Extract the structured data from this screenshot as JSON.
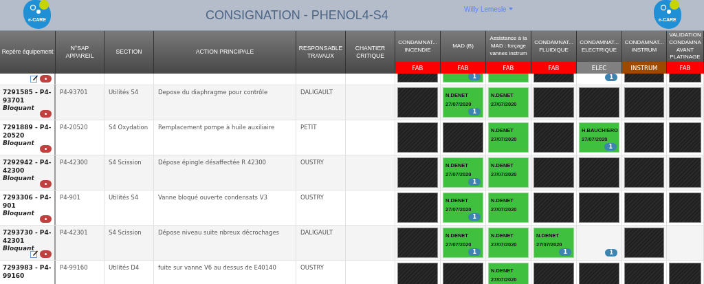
{
  "header": {
    "logo_text": "e-CARE",
    "title": "CONSIGNATION - PHENOL4-S4",
    "user": "Willy Lemesle",
    "logo_text_right": "e-CARE"
  },
  "columns": [
    {
      "kind": "plain",
      "label": "Repère équipement"
    },
    {
      "kind": "plain",
      "label": "N°SAP APPAREIL"
    },
    {
      "kind": "plain",
      "label": "SECTION"
    },
    {
      "kind": "plain",
      "label": "ACTION PRINCIPALE"
    },
    {
      "kind": "plain",
      "label": "RESPONSABLE TRAVAUX"
    },
    {
      "kind": "plain",
      "label": "CHANTIER CRITIQUE"
    },
    {
      "kind": "status",
      "label": "CONDAMNAT... INCENDIE",
      "category": "FAB",
      "color": "#ff0000"
    },
    {
      "kind": "status",
      "label": "MAD (B)",
      "category": "FAB",
      "color": "#ff0000"
    },
    {
      "kind": "status",
      "label": "Assistance à la MAD : forçage vannes instrum",
      "category": "FAB",
      "color": "#ff0000"
    },
    {
      "kind": "status",
      "label": "CONDAMNAT... FLUIDIQUE",
      "category": "FAB",
      "color": "#ff0000"
    },
    {
      "kind": "status",
      "label": "CONDAMNAT... ELECTRIQUE",
      "category": "ELEC",
      "color": "#808080"
    },
    {
      "kind": "status",
      "label": "CONDAMNAT... INSTRUM",
      "category": "INSTRUM",
      "color": "#9c4a00"
    },
    {
      "kind": "status",
      "label": "VALIDATION CONDAMNA AVANT PLATINAGE",
      "category": "FAB",
      "color": "#ff0000"
    }
  ],
  "rows": [
    {
      "partial": true,
      "edit": true,
      "cells": [
        {
          "kind": "blocked"
        },
        {
          "kind": "done",
          "badge": "1"
        },
        {
          "kind": "done"
        },
        {
          "kind": "blocked"
        },
        {
          "kind": "open",
          "badge": "1"
        },
        {
          "kind": "blocked"
        },
        {
          "kind": "blocked"
        }
      ]
    },
    {
      "partial": false,
      "edit": false,
      "id": "7291585 - P4-93701",
      "status": "Bloquant",
      "sap": "P4-93701",
      "section": "Utilités S4",
      "action": "Depose du diaphragme pour contrôle",
      "responsable": "DALIGAULT",
      "cells": [
        {
          "kind": "blocked"
        },
        {
          "kind": "done",
          "name": "N.DENET",
          "date": "27/07/2020",
          "badge": "1"
        },
        {
          "kind": "done",
          "name": "N.DENET",
          "date": "27/07/2020"
        },
        {
          "kind": "blocked"
        },
        {
          "kind": "blocked"
        },
        {
          "kind": "blocked"
        },
        {
          "kind": "blocked"
        }
      ]
    },
    {
      "partial": false,
      "edit": false,
      "id": "7291889 - P4-20520",
      "status": "Bloquant",
      "sap": "P4-20520",
      "section": "S4 Oxydation",
      "action": "Remplacement pompe à huile auxiliaire",
      "responsable": "PETIT",
      "cells": [
        {
          "kind": "blocked"
        },
        {
          "kind": "blocked"
        },
        {
          "kind": "done",
          "name": "N.DENET",
          "date": "27/07/2020"
        },
        {
          "kind": "blocked"
        },
        {
          "kind": "done",
          "name": "H.BAUCHIERO",
          "date": "27/07/2020",
          "badge": "1"
        },
        {
          "kind": "blocked"
        },
        {
          "kind": "blocked"
        }
      ]
    },
    {
      "partial": false,
      "edit": false,
      "id": "7292942 - P4-42300",
      "status": "Bloquant",
      "sap": "P4-42300",
      "section": "S4 Scission",
      "action": "Dépose épingle désaffectée R 42300",
      "responsable": "OUSTRY",
      "cells": [
        {
          "kind": "blocked"
        },
        {
          "kind": "done",
          "name": "N.DENET",
          "date": "27/07/2020",
          "badge": "1"
        },
        {
          "kind": "done",
          "name": "N.DENET",
          "date": "27/07/2020"
        },
        {
          "kind": "blocked"
        },
        {
          "kind": "blocked"
        },
        {
          "kind": "blocked"
        },
        {
          "kind": "blocked"
        }
      ]
    },
    {
      "partial": false,
      "edit": false,
      "id": "7293306 - P4-901",
      "status": "Bloquant",
      "sap": "P4-901",
      "section": "Utilités S4",
      "action": "Vanne bloqué ouverte condensats V3",
      "responsable": "OUSTRY",
      "cells": [
        {
          "kind": "blocked"
        },
        {
          "kind": "done",
          "name": "N.DENET",
          "date": "27/07/2020",
          "badge": "1"
        },
        {
          "kind": "done",
          "name": "N.DENET",
          "date": "27/07/2020"
        },
        {
          "kind": "blocked"
        },
        {
          "kind": "blocked"
        },
        {
          "kind": "blocked"
        },
        {
          "kind": "blocked"
        }
      ]
    },
    {
      "partial": false,
      "edit": true,
      "id": "7293730 - P4-42301",
      "status": "Bloquant",
      "sap": "P4-42301",
      "section": "S4 Scission",
      "action": "Dépose niveau suite nbreux décrochages",
      "responsable": "DALIGAULT",
      "cells": [
        {
          "kind": "blocked"
        },
        {
          "kind": "done",
          "name": "N.DENET",
          "date": "27/07/2020",
          "badge": "1"
        },
        {
          "kind": "done",
          "name": "N.DENET",
          "date": "27/07/2020"
        },
        {
          "kind": "done",
          "name": "N.DENET",
          "date": "27/07/2020",
          "badge": "1"
        },
        {
          "kind": "open",
          "badge": "1"
        },
        {
          "kind": "blocked"
        },
        {
          "kind": "open"
        }
      ]
    },
    {
      "partial": false,
      "edit": false,
      "id": "7293983 - P4-99160",
      "sap": "P4-99160",
      "section": "Utilités D4",
      "action": "fuite sur vanne V6 au dessus de E40140",
      "responsable": "OUSTRY",
      "cells": [
        {
          "kind": "blocked"
        },
        {
          "kind": "blocked"
        },
        {
          "kind": "done",
          "name": "N.DENET",
          "date": "27/07/2020"
        },
        {
          "kind": "blocked"
        },
        {
          "kind": "blocked"
        },
        {
          "kind": "blocked"
        },
        {
          "kind": "blocked"
        }
      ]
    }
  ]
}
